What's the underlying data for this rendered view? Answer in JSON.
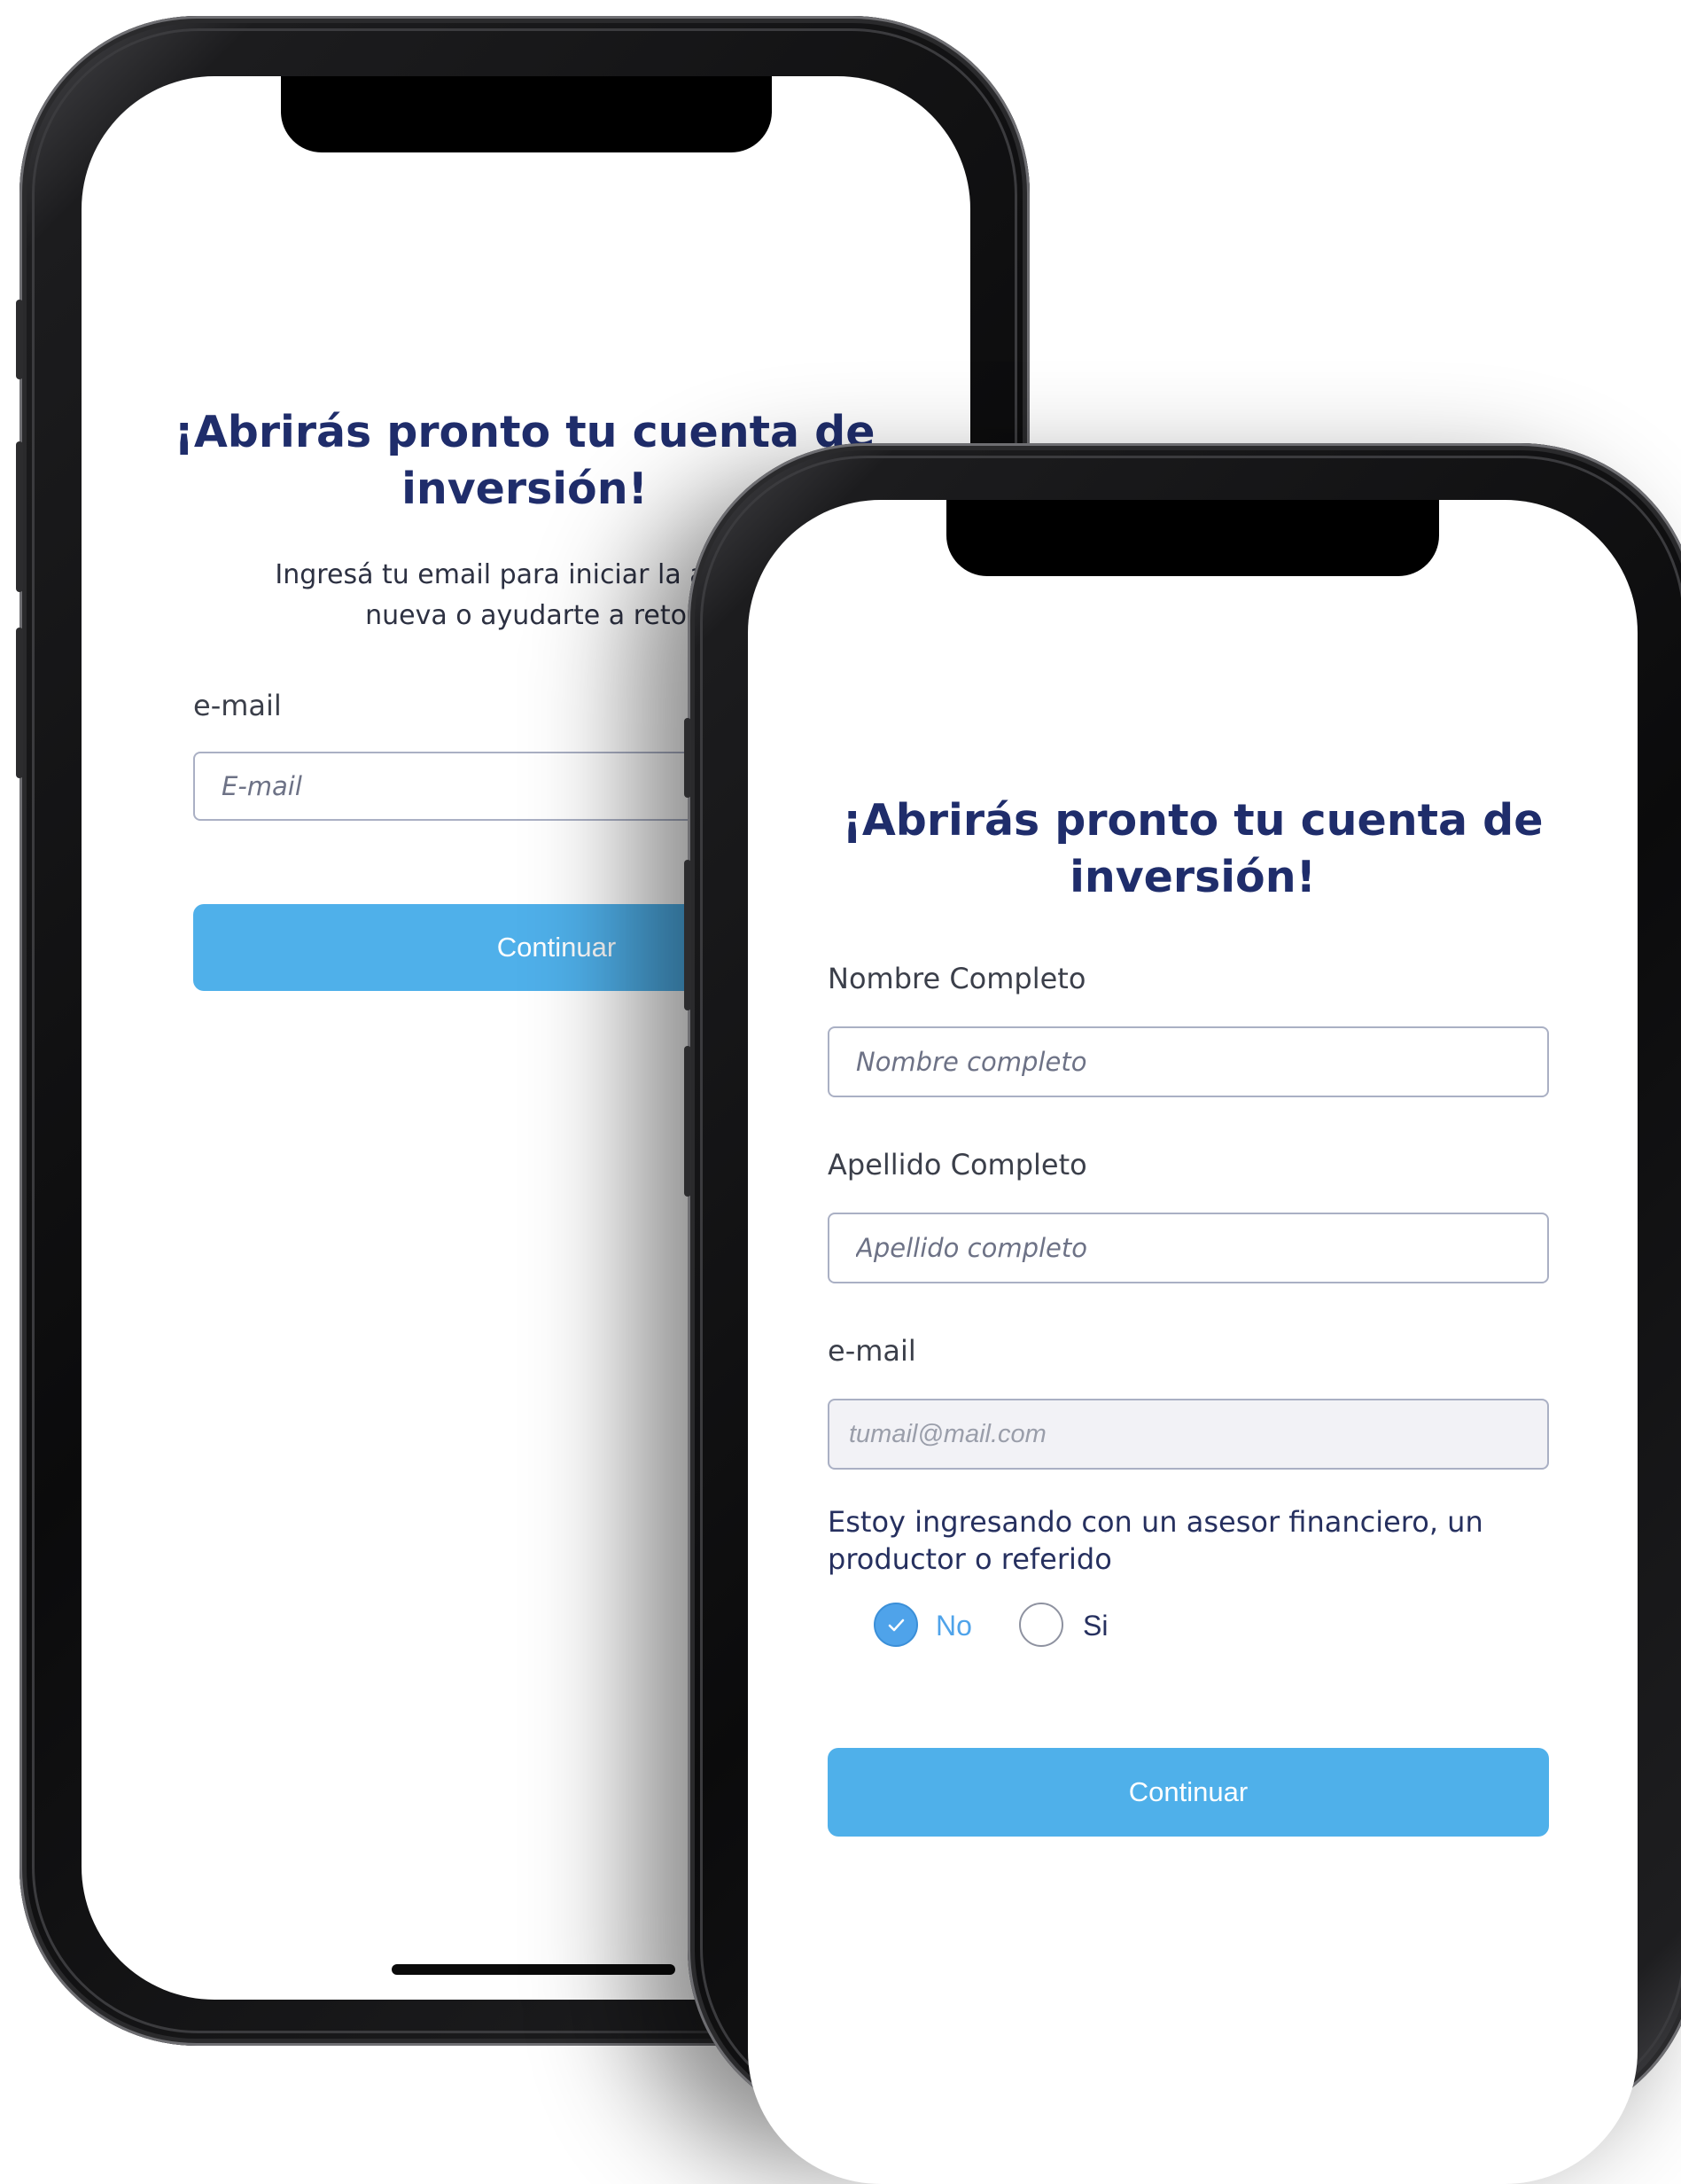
{
  "screen1": {
    "title": "¡Abrirás pronto tu cuenta de inversión!",
    "subtitle_line1": "Ingresá tu email para iniciar la apertura d",
    "subtitle_line2": "nueva o ayudarte a retomar",
    "email_label": "e-mail",
    "email_placeholder": "E-mail",
    "continue_label": "Continuar"
  },
  "screen2": {
    "title": "¡Abrirás pronto tu cuenta de inversión!",
    "name_label": "Nombre Completo",
    "name_placeholder": "Nombre completo",
    "lastname_label": "Apellido Completo",
    "lastname_placeholder": "Apellido completo",
    "email_label": "e-mail",
    "email_placeholder": "tumail@mail.com",
    "advisor_question": "Estoy ingresando con un asesor financiero, un productor o referido",
    "options": [
      {
        "label": "No",
        "selected": true
      },
      {
        "label": "Si",
        "selected": false
      }
    ],
    "continue_label": "Continuar"
  },
  "colors": {
    "title": "#1f2d6b",
    "button": "#4fb0ea",
    "radio_selected": "#4fa3ea",
    "frame": "#0b0b0c"
  },
  "icons": {
    "radio_check": "check-icon"
  }
}
